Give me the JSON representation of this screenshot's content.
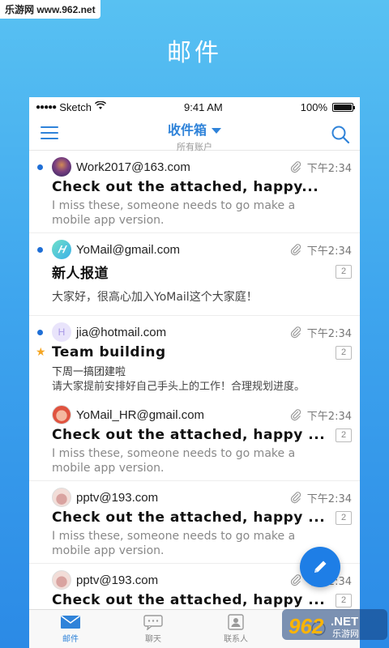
{
  "watermark": {
    "top_text": "乐游网 www.962.net",
    "bottom_text": "962.NET",
    "bottom_sub": "乐游网"
  },
  "page_heading": "邮件",
  "status_bar": {
    "carrier": "Sketch",
    "time": "9:41 AM",
    "battery": "100%"
  },
  "nav": {
    "title": "收件箱",
    "subtitle": "所有账户"
  },
  "colors": {
    "accent": "#2f83d9",
    "unread": "#1f6fd6",
    "star": "#f5a623",
    "fab": "#1e7ee6"
  },
  "mails": [
    {
      "sender": "Work2017@163.com",
      "time": "下午2:34",
      "subject": "Check out the attached, happy...",
      "preview": "I miss these, someone needs to go make a mobile app version.",
      "unread": true,
      "starred": false,
      "count": "",
      "avatar": "photo-avatar-dark"
    },
    {
      "sender": "YoMail@gmail.com",
      "time": "下午2:34",
      "subject": "新人报道",
      "preview": "大家好，很高心加入YoMail这个大家庭！",
      "unread": true,
      "starred": false,
      "count": "2",
      "avatar": "yomail-logo-avatar"
    },
    {
      "sender": "jia@hotmail.com",
      "time": "下午2:34",
      "subject": "Team building",
      "subline": "下周一搞团建啦",
      "preview": "请大家提前安排好自己手头上的工作！合理规划进度。",
      "unread": true,
      "starred": true,
      "count": "2",
      "avatar": "letter-avatar-h"
    },
    {
      "sender": "YoMail_HR@gmail.com",
      "time": "下午2:34",
      "subject": "Check out the attached, happy ...",
      "preview": "I miss these, someone needs to go make a mobile app version.",
      "unread": false,
      "starred": false,
      "count": "2",
      "avatar": "cartoon-avatar-red"
    },
    {
      "sender": "pptv@193.com",
      "time": "下午2:34",
      "subject": "Check out the attached, happy ...",
      "preview": "I miss these, someone needs to go make a mobile app version.",
      "unread": false,
      "starred": false,
      "count": "2",
      "avatar": "cartoon-avatar-bunny"
    },
    {
      "sender": "pptv@193.com",
      "time": "下午2:34",
      "subject": "Check out the attached, happy ...",
      "preview": "",
      "unread": false,
      "starred": false,
      "count": "2",
      "avatar": "cartoon-avatar-bunny"
    }
  ],
  "avatar_letter": "H",
  "tabs": [
    {
      "label": "邮件",
      "icon": "mail-icon",
      "active": true
    },
    {
      "label": "聊天",
      "icon": "chat-icon",
      "active": false
    },
    {
      "label": "联系人",
      "icon": "contacts-icon",
      "active": false
    },
    {
      "label": "",
      "icon": "more-icon",
      "active": false
    }
  ]
}
